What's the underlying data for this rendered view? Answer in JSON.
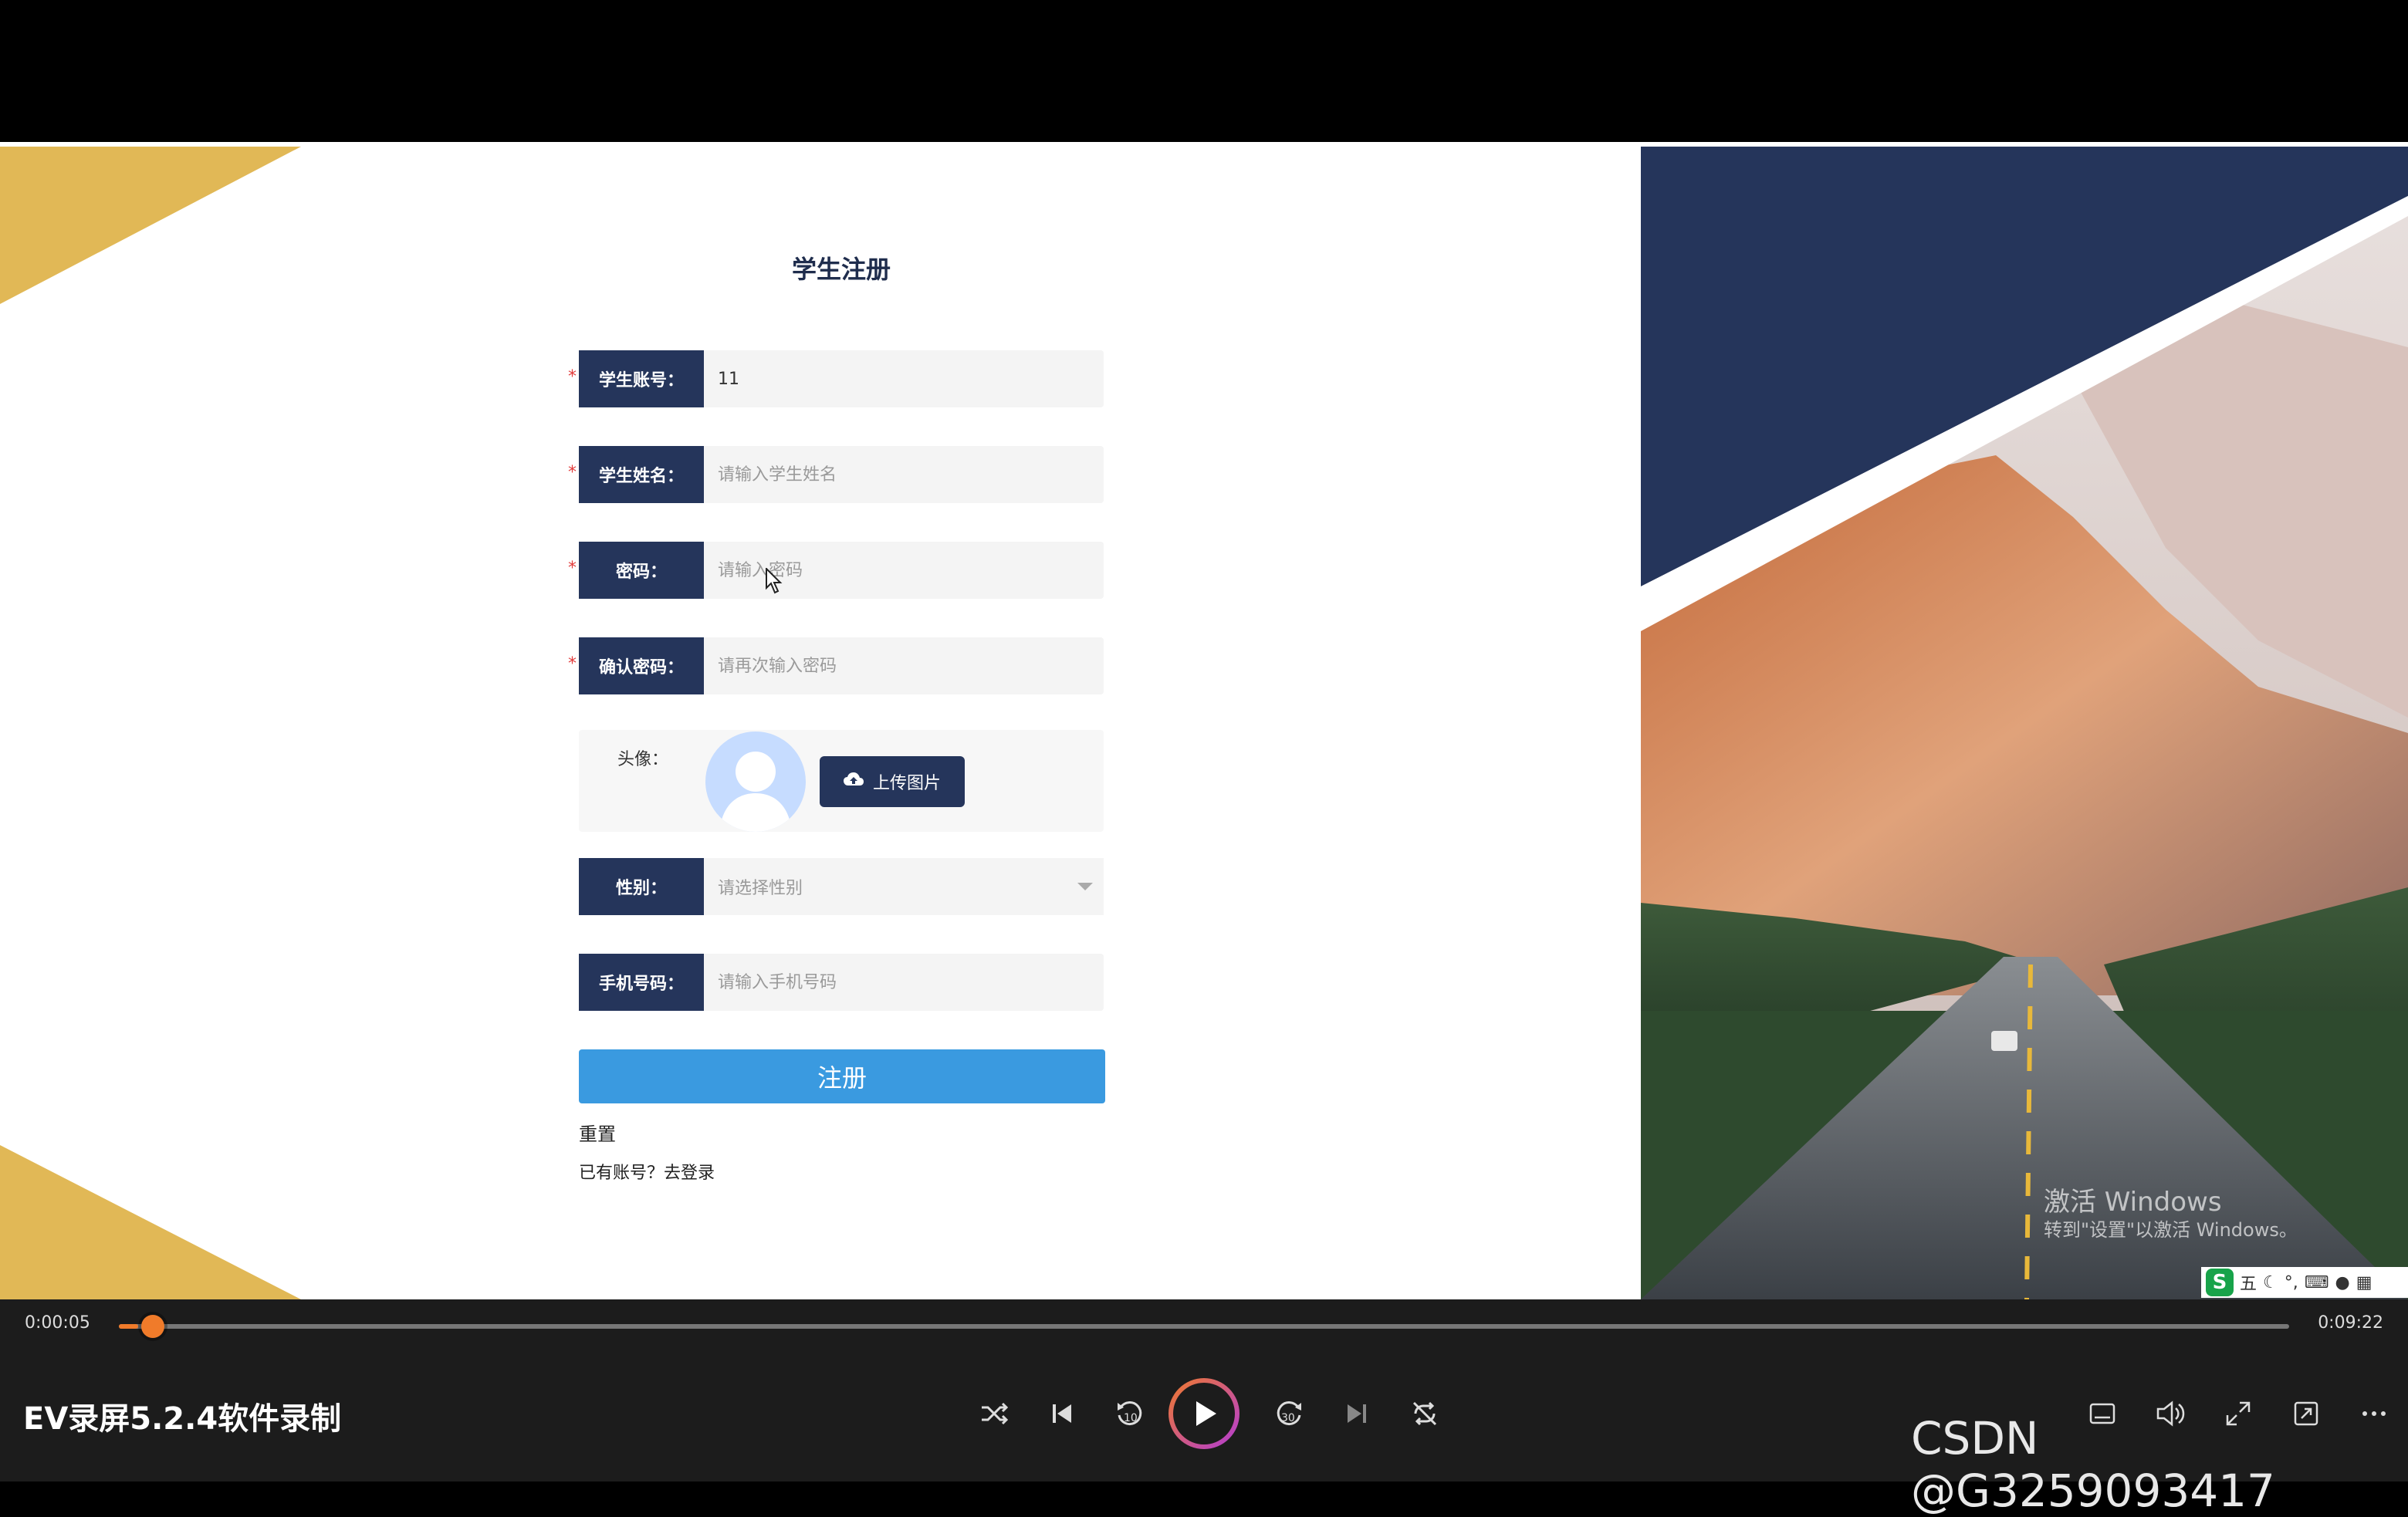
{
  "form": {
    "title": "学生注册",
    "account": {
      "label": "学生账号：",
      "value": "11",
      "required": "*"
    },
    "name": {
      "label": "学生姓名：",
      "placeholder": "请输入学生姓名",
      "required": "*"
    },
    "password": {
      "label": "密码：",
      "placeholder": "请输入密码",
      "required": "*"
    },
    "confirm": {
      "label": "确认密码：",
      "placeholder": "请再次输入密码",
      "required": "*"
    },
    "avatar": {
      "label": "头像：",
      "upload_label": "上传图片"
    },
    "gender": {
      "label": "性别：",
      "placeholder": "请选择性别"
    },
    "phone": {
      "label": "手机号码：",
      "placeholder": "请输入手机号码"
    },
    "register_label": "注册",
    "reset_label": "重置",
    "login_link": "已有账号？去登录"
  },
  "overlay": {
    "watermark_title": "激活 Windows",
    "watermark_sub": "转到\"设置\"以激活 Windows。",
    "ime_text": "五"
  },
  "player": {
    "current_time": "0:00:05",
    "total_time": "0:09:22",
    "progress": 0.009,
    "title": "EV录屏5.2.4软件录制",
    "rewind_label": "10",
    "forward_label": "30",
    "credit": "CSDN @G3259093417"
  },
  "colors": {
    "navy": "#25355b",
    "gold": "#e1b856",
    "accent": "#3a9ae0",
    "progress": "#f07b2a"
  }
}
